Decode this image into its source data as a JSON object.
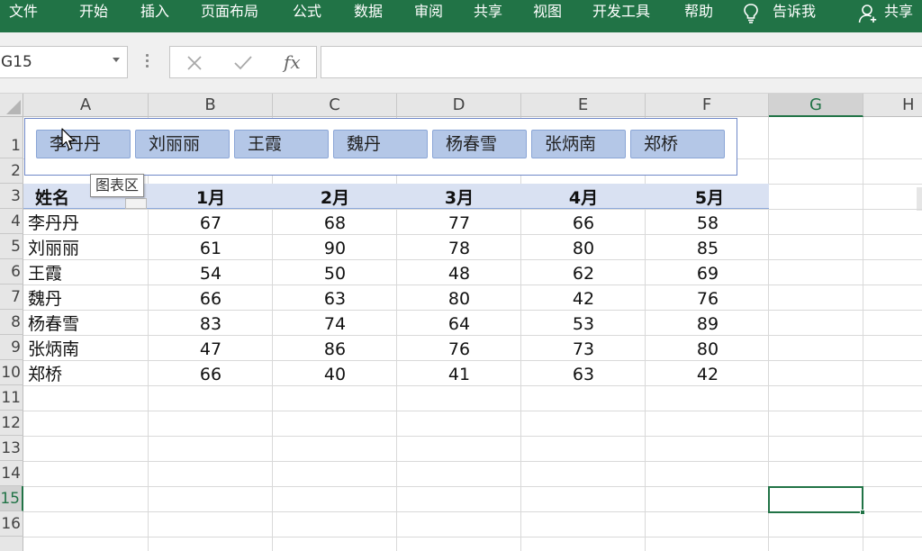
{
  "ribbon": {
    "menu": [
      "文件",
      "开始",
      "插入",
      "页面布局",
      "公式",
      "数据",
      "审阅",
      "共享",
      "视图",
      "开发工具",
      "帮助"
    ],
    "tell_me": "告诉我",
    "share": "共享",
    "colors": {
      "ribbon": "#217346"
    }
  },
  "formula_bar": {
    "name_box": "G15",
    "fx_label": "fx",
    "formula_value": ""
  },
  "columns": [
    "A",
    "B",
    "C",
    "D",
    "E",
    "F",
    "G",
    "H"
  ],
  "rows": [
    "1",
    "2",
    "3",
    "4",
    "5",
    "6",
    "7",
    "8",
    "9",
    "10",
    "11",
    "12",
    "13",
    "14",
    "15",
    "16"
  ],
  "table": {
    "headers": [
      "姓名",
      "1月",
      "2月",
      "3月",
      "4月",
      "5月"
    ],
    "rows": [
      [
        "李丹丹",
        "67",
        "68",
        "77",
        "66",
        "58"
      ],
      [
        "刘丽丽",
        "61",
        "90",
        "78",
        "80",
        "85"
      ],
      [
        "王霞",
        "54",
        "50",
        "48",
        "62",
        "69"
      ],
      [
        "魏丹",
        "66",
        "63",
        "80",
        "42",
        "76"
      ],
      [
        "杨春雪",
        "83",
        "74",
        "64",
        "53",
        "89"
      ],
      [
        "张炳南",
        "47",
        "86",
        "76",
        "73",
        "80"
      ],
      [
        "郑桥",
        "66",
        "40",
        "41",
        "63",
        "42"
      ]
    ]
  },
  "slicer": {
    "items": [
      "李丹丹",
      "刘丽丽",
      "王霞",
      "魏丹",
      "杨春雪",
      "张炳南",
      "郑桥"
    ],
    "tooltip": "图表区"
  },
  "icons": {
    "tell_me": "lightbulb-icon",
    "share": "user-add-icon",
    "cancel": "close-icon",
    "enter": "check-icon",
    "insert_function": "fx-icon",
    "name_box_dropdown": "chevron-down-icon",
    "cursor": "mouse-pointer-icon"
  }
}
